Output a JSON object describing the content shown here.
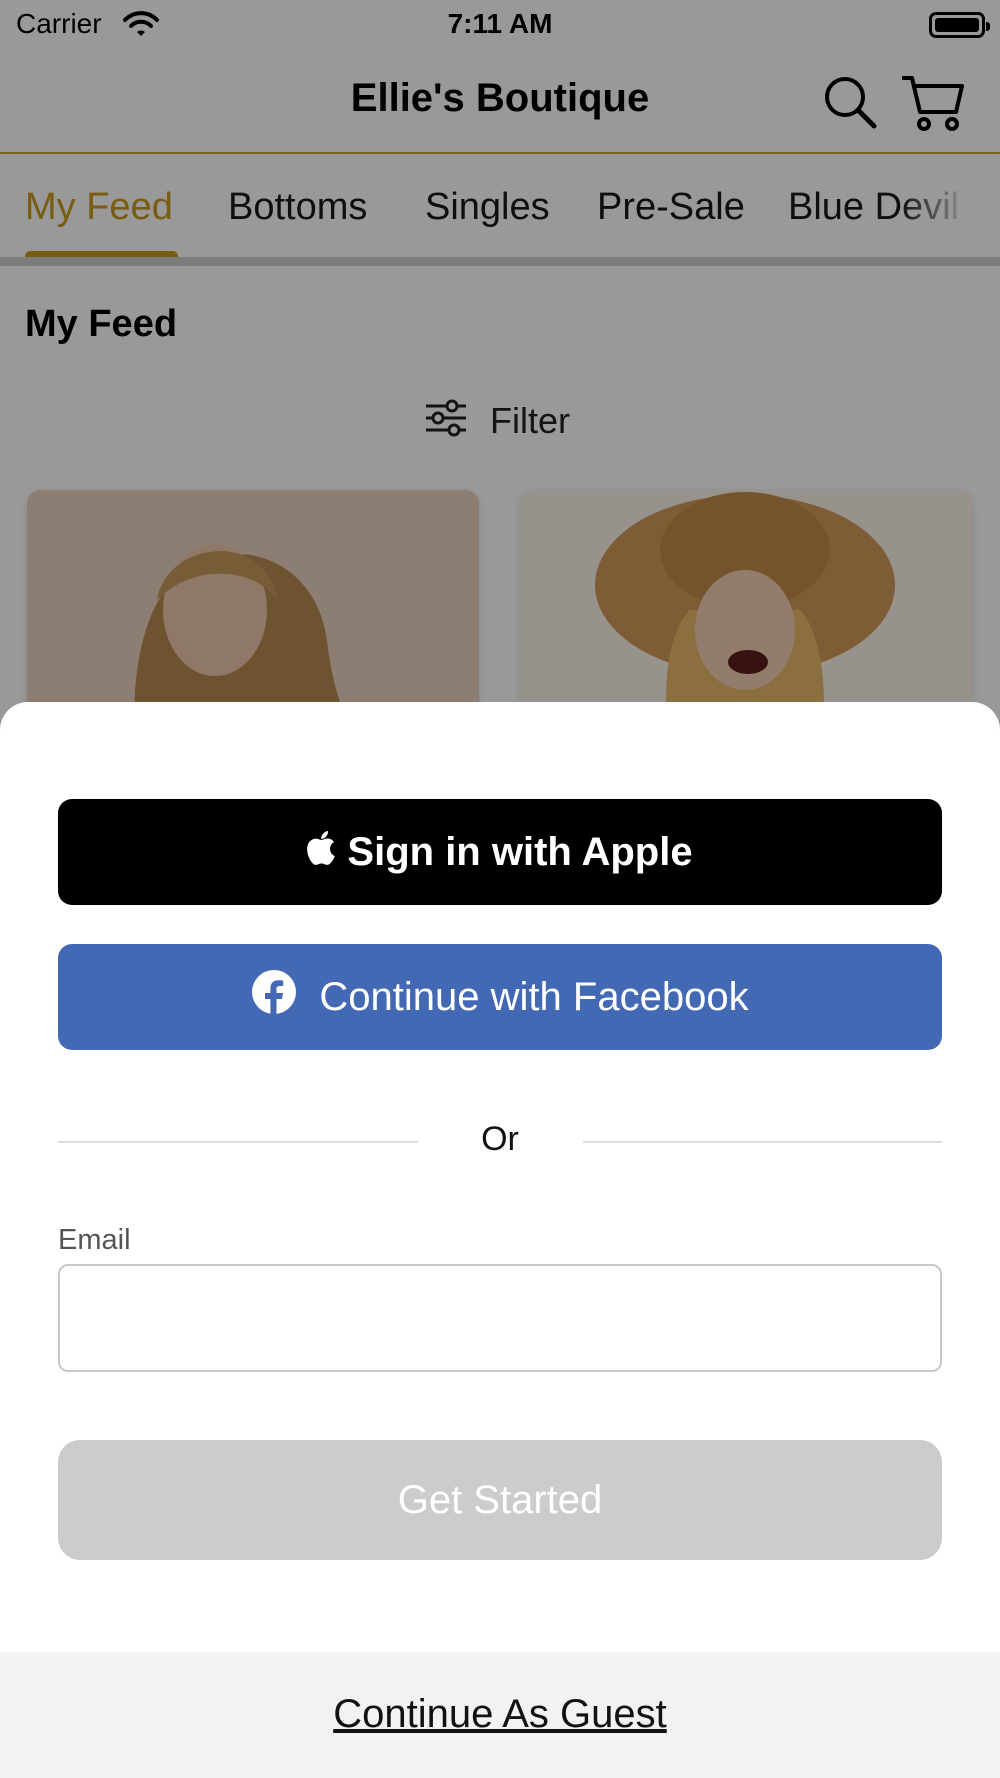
{
  "status_bar": {
    "carrier": "Carrier",
    "time": "7:11 AM"
  },
  "header": {
    "title": "Ellie's Boutique",
    "search_icon": "search-icon",
    "cart_icon": "cart-icon"
  },
  "tabs": [
    {
      "label": "My Feed",
      "active": true
    },
    {
      "label": "Bottoms",
      "active": false
    },
    {
      "label": "Singles",
      "active": false
    },
    {
      "label": "Pre-Sale",
      "active": false
    },
    {
      "label": "Blue Devil",
      "active": false
    }
  ],
  "feed": {
    "title": "My Feed",
    "filter_label": "Filter",
    "filter_icon": "sliders-icon"
  },
  "sign_in_sheet": {
    "apple_button": "Sign in with Apple",
    "facebook_button": "Continue with Facebook",
    "divider_text": "Or",
    "email_label": "Email",
    "email_value": "",
    "get_started_button": "Get Started",
    "guest_link": "Continue As Guest"
  },
  "colors": {
    "accent": "#c99a1a",
    "facebook_blue": "#4469b4",
    "disabled_button": "#cccccc",
    "apple_button": "#000000"
  }
}
